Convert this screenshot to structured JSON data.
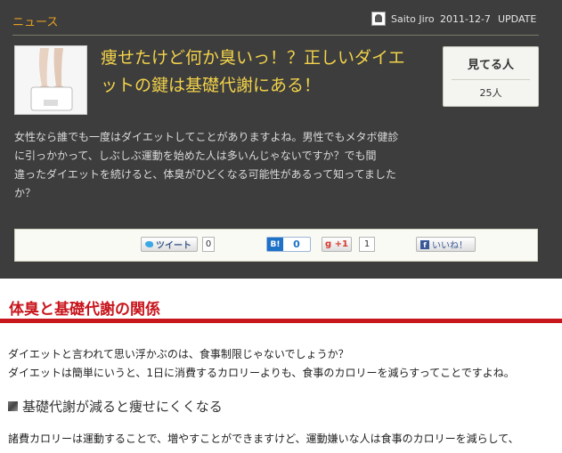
{
  "header": {
    "category": "ニュース",
    "author": "Saito Jiro",
    "date": "2011-12-7",
    "update_label": "UPDATE"
  },
  "article": {
    "title_line1": "痩せたけど何か臭いっ！？正しいダイエ",
    "title_line2": "ットの鍵は基礎代謝にある！",
    "thumbnail_icon": "scale-feet-photo",
    "excerpt_lines": [
      "女性なら誰でも一度はダイエットしてことがありますよね。男性でもメタボ健診",
      "に引っかかって、しぶしぶ運動を始めた人は多いんじゃないですか？でも間",
      "違ったダイエットを続けると、体臭がひどくなる可能性があるって知ってました",
      "か？"
    ]
  },
  "views": {
    "label": "見てる人",
    "count": "25人"
  },
  "share": {
    "tweet_label": "ツイート",
    "tweet_count": "0",
    "hatena_icon": "B!",
    "hatena_count": "0",
    "gplus_icon": "g",
    "gplus_label": "+1",
    "gplus_count": "1",
    "facebook_label": "いいね！"
  },
  "content": {
    "heading": "体臭と基礎代謝の関係",
    "para1_lines": [
      "ダイエットと言われて思い浮かぶのは、食事制限じゃないでしょうか？",
      "ダイエットは簡単にいうと、1日に消費するカロリーよりも、食事のカロリーを減らすってことですよね。"
    ],
    "subheading": "基礎代謝が減ると痩せにくくなる",
    "para2": "諸費カロリーは運動することで、増やすことができますけど、運動嫌いな人は食事のカロリーを減らして、"
  },
  "colors": {
    "dark_bg": "#3d3d3d",
    "category": "#e8a020",
    "title": "#f2d24a",
    "heading_red": "#c8161d"
  }
}
